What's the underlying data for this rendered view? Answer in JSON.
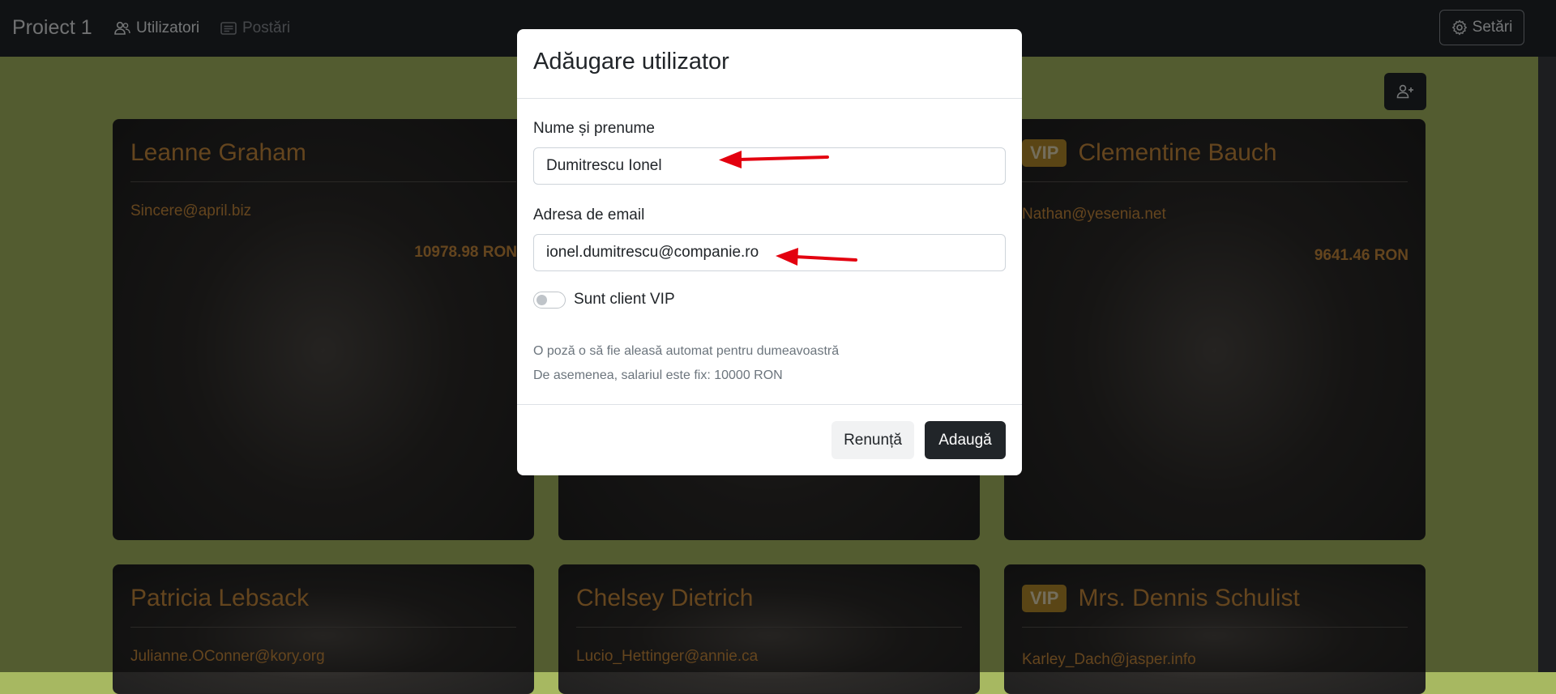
{
  "navbar": {
    "brand": "Proiect 1",
    "links": [
      {
        "label": "Utilizatori",
        "icon": "users-icon",
        "active": true
      },
      {
        "label": "Postări",
        "icon": "card-text-icon",
        "active": false
      }
    ],
    "settings_label": "Setări",
    "settings_icon": "gear-icon"
  },
  "toolbar": {
    "add_user_icon": "person-plus-icon"
  },
  "users": [
    {
      "name": "Leanne Graham",
      "email": "Sincere@april.biz",
      "salary": "10978.98 RON",
      "vip": false
    },
    {
      "name": "",
      "email": "",
      "salary": "",
      "vip": false
    },
    {
      "name": "Clementine Bauch",
      "email": "Nathan@yesenia.net",
      "salary": "9641.46 RON",
      "vip": true
    },
    {
      "name": "Patricia Lebsack",
      "email": "Julianne.OConner@kory.org",
      "salary": "",
      "vip": false
    },
    {
      "name": "Chelsey Dietrich",
      "email": "Lucio_Hettinger@annie.ca",
      "salary": "",
      "vip": false
    },
    {
      "name": "Mrs. Dennis Schulist",
      "email": "Karley_Dach@jasper.info",
      "salary": "",
      "vip": true
    }
  ],
  "vip_badge": "VIP",
  "modal": {
    "title": "Adăugare utilizator",
    "name_label": "Nume și prenume",
    "name_value": "Dumitrescu Ionel",
    "email_label": "Adresa de email",
    "email_value": "ionel.dumitrescu@companie.ro",
    "vip_label": "Sunt client VIP",
    "vip_checked": false,
    "note_line1": "O poză o să fie aleasă automat pentru dumeavoastră",
    "note_line2": "De asemenea, salariul este fix: 10000 RON",
    "cancel_label": "Renunță",
    "add_label": "Adaugă"
  },
  "annotation": {
    "arrow_color": "#e3000f"
  },
  "colors": {
    "navbar_bg": "#212529",
    "page_bg": "#a7b861",
    "card_text": "#c98a3c",
    "vip_badge_bg": "#b58b2a",
    "primary_btn": "#212529"
  }
}
